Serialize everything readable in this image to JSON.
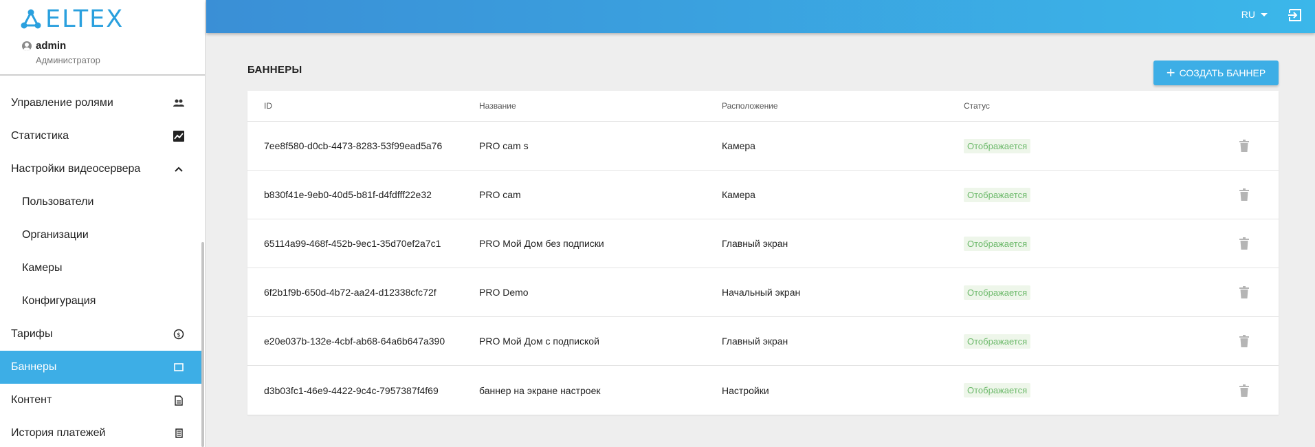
{
  "brand": {
    "logo_text": "ELTEX"
  },
  "user": {
    "name": "admin",
    "role": "Администратор"
  },
  "sidebar": {
    "items": [
      {
        "label": "Управление ролями",
        "icon": "people-icon"
      },
      {
        "label": "Статистика",
        "icon": "chart-icon"
      },
      {
        "label": "Настройки видеосервера",
        "icon": "chevron-up-icon"
      },
      {
        "label": "Пользователи"
      },
      {
        "label": "Организации"
      },
      {
        "label": "Камеры"
      },
      {
        "label": "Конфигурация"
      },
      {
        "label": "Тарифы",
        "icon": "dollar-icon"
      },
      {
        "label": "Баннеры",
        "icon": "square-icon",
        "active": true
      },
      {
        "label": "Контент",
        "icon": "document-icon"
      },
      {
        "label": "История платежей",
        "icon": "receipt-icon"
      }
    ]
  },
  "header": {
    "lang": "RU"
  },
  "page": {
    "title": "БАННЕРЫ",
    "create_label": "СОЗДАТЬ БАННЕР"
  },
  "table": {
    "columns": [
      "ID",
      "Название",
      "Расположение",
      "Статус"
    ],
    "rows": [
      {
        "id": "7ee8f580-d0cb-4473-8283-53f99ead5a76",
        "name": "PRO cam s",
        "location": "Камера",
        "status": "Отображается"
      },
      {
        "id": "b830f41e-9eb0-40d5-b81f-d4fdfff22e32",
        "name": "PRO cam",
        "location": "Камера",
        "status": "Отображается"
      },
      {
        "id": "65114a99-468f-452b-9ec1-35d70ef2a7c1",
        "name": "PRO Мой Дом без подписки",
        "location": "Главный экран",
        "status": "Отображается"
      },
      {
        "id": "6f2b1f9b-650d-4b72-aa24-d12338cfc72f",
        "name": "PRO Demo",
        "location": "Начальный экран",
        "status": "Отображается"
      },
      {
        "id": "e20e037b-132e-4cbf-ab68-64a6b647a390",
        "name": "PRO Мой Дом с подпиской",
        "location": "Главный экран",
        "status": "Отображается"
      },
      {
        "id": "d3b03fc1-46e9-4422-9c4c-7957387f4f69",
        "name": "баннер на экране настроек",
        "location": "Настройки",
        "status": "Отображается"
      }
    ]
  },
  "colors": {
    "accent": "#3daee6",
    "status_text": "#6cb96a",
    "status_bg": "#eef6ea"
  }
}
